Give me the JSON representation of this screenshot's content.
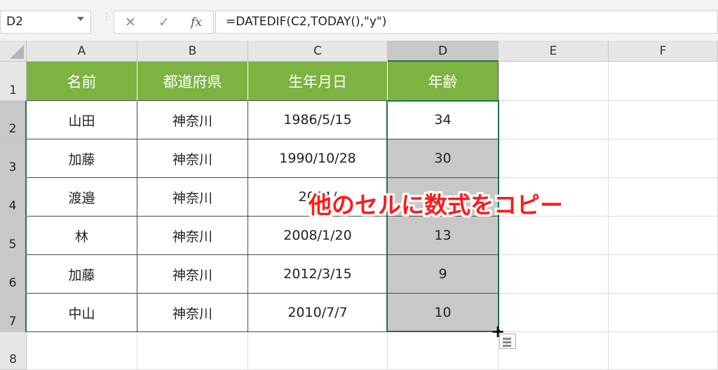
{
  "formula_bar": {
    "name_box": "D2",
    "cancel_icon": "✕",
    "enter_icon": "✓",
    "fx_label": "fx",
    "formula": "=DATEDIF(C2,TODAY(),\"y\")"
  },
  "columns": [
    "A",
    "B",
    "C",
    "D",
    "E",
    "F"
  ],
  "rows": [
    "1",
    "2",
    "3",
    "4",
    "5",
    "6",
    "7",
    "8"
  ],
  "selected_column": "D",
  "table": {
    "headers": [
      "名前",
      "都道府県",
      "生年月日",
      "年齢"
    ],
    "rows": [
      [
        "山田",
        "神奈川",
        "1986/5/15",
        "34"
      ],
      [
        "加藤",
        "神奈川",
        "1990/10/28",
        "30"
      ],
      [
        "渡邉",
        "神奈川",
        "2001/",
        ""
      ],
      [
        "林",
        "神奈川",
        "2008/1/20",
        "13"
      ],
      [
        "加藤",
        "神奈川",
        "2012/3/15",
        "9"
      ],
      [
        "中山",
        "神奈川",
        "2010/7/7",
        "10"
      ]
    ]
  },
  "annotation": "他のセルに数式をコピー",
  "colors": {
    "header_fill": "#7cb341",
    "selection": "#217346",
    "shaded": "#c8c8c8",
    "annotation": "#ff1a1a"
  }
}
